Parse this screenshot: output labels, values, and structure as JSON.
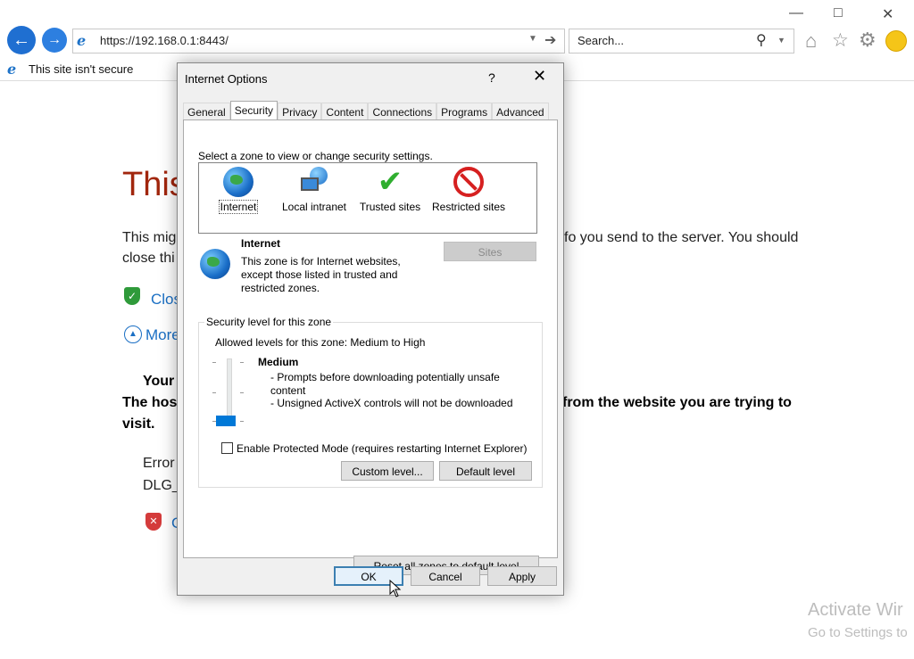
{
  "browser": {
    "url": "https://192.168.0.1:8443/",
    "search_placeholder": "Search...",
    "tab_title": "This site isn't secure"
  },
  "error_page": {
    "title": "This",
    "desc_left": "This mig",
    "desc_right": "fo you send to the server. You should",
    "desc_line2": "close thi",
    "close_link": "Clos",
    "more_link": "More",
    "your_text": "Your",
    "host_left": "The hos",
    "host_right": "from the website you are trying to",
    "visit": "visit.",
    "error_label": "Error",
    "error_code": "DLG_",
    "c_link": "C"
  },
  "watermark": {
    "line1": "Activate Wir",
    "line2": "Go to Settings to"
  },
  "dialog": {
    "title": "Internet Options",
    "help": "?",
    "close": "✕",
    "tabs": [
      "General",
      "Security",
      "Privacy",
      "Content",
      "Connections",
      "Programs",
      "Advanced"
    ],
    "zone_prompt": "Select a zone to view or change security settings.",
    "zones": [
      "Internet",
      "Local intranet",
      "Trusted sites",
      "Restricted sites"
    ],
    "zone_name": "Internet",
    "zone_desc_1": "This zone is for Internet websites,",
    "zone_desc_2": "except those listed in trusted and",
    "zone_desc_3": "restricted zones.",
    "sites_button": "Sites",
    "security_group_label": "Security level for this zone",
    "allowed_levels": "Allowed levels for this zone: Medium to High",
    "level_name": "Medium",
    "level_desc_1": "- Prompts before downloading potentially unsafe",
    "level_desc_2": "content",
    "level_desc_3": "- Unsigned ActiveX controls will not be downloaded",
    "protected_mode_label": "Enable Protected Mode (requires restarting Internet Explorer)",
    "protected_mode_checked": false,
    "custom_level_button": "Custom level...",
    "default_level_button": "Default level",
    "reset_all_button": "Reset all zones to default level",
    "ok_button": "OK",
    "cancel_button": "Cancel",
    "apply_button": "Apply"
  }
}
